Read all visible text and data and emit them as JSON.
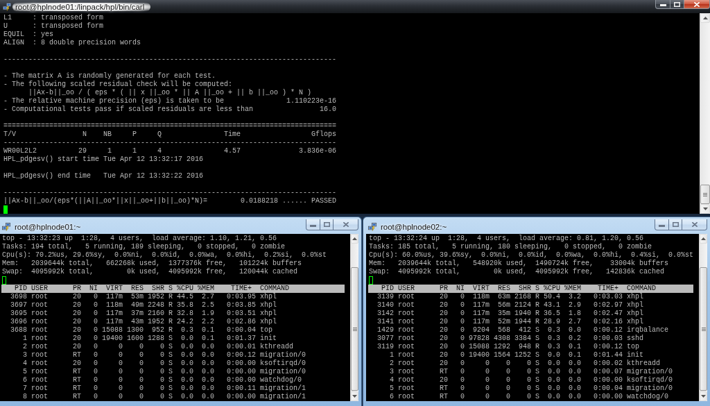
{
  "top_window": {
    "title": "root@hplnode01:/linpack/hpl/bin/carl",
    "active": true,
    "lines": [
      {
        "kind": "text",
        "text": "L1     : transposed form"
      },
      {
        "kind": "text",
        "text": "U      : transposed form"
      },
      {
        "kind": "text",
        "text": "EQUIL  : yes"
      },
      {
        "kind": "text",
        "text": "ALIGN  : 8 double precision words"
      },
      {
        "kind": "blank"
      },
      {
        "kind": "text",
        "text": "--------------------------------------------------------------------------------"
      },
      {
        "kind": "blank"
      },
      {
        "kind": "text",
        "text": "- The matrix A is randomly generated for each test."
      },
      {
        "kind": "text",
        "text": "- The following scaled residual check will be computed:"
      },
      {
        "kind": "text",
        "text": "      ||Ax-b||_oo / ( eps * ( || x ||_oo * || A ||_oo + || b ||_oo ) * N )"
      },
      {
        "kind": "text",
        "text": "- The relative machine precision (eps) is taken to be               1.110223e-16"
      },
      {
        "kind": "text",
        "text": "- Computational tests pass if scaled residuals are less than                16.0"
      },
      {
        "kind": "blank"
      },
      {
        "kind": "text",
        "text": "================================================================================"
      },
      {
        "kind": "text",
        "text": "T/V                N    NB     P     Q               Time                 Gflops"
      },
      {
        "kind": "text",
        "text": "--------------------------------------------------------------------------------"
      },
      {
        "kind": "text",
        "text": "WR00L2L2          29     1     1     4               4.57              3.836e-06"
      },
      {
        "kind": "text",
        "text": "HPL_pdgesv() start time Tue Apr 12 13:32:17 2016"
      },
      {
        "kind": "blank"
      },
      {
        "kind": "text",
        "text": "HPL_pdgesv() end time   Tue Apr 12 13:32:22 2016"
      },
      {
        "kind": "blank"
      },
      {
        "kind": "text",
        "text": "--------------------------------------------------------------------------------"
      },
      {
        "kind": "text",
        "text": "||Ax-b||_oo/(eps*(||A||_oo*||x||_oo+||b||_oo)*N)=        0.0188218 ...... PASSED"
      }
    ]
  },
  "bottom_windows": [
    {
      "title": "root@hplnode01:~",
      "active": false,
      "summary_lines": [
        "top - 13:32:23 up  1:28,  4 users,  load average: 1.10, 1.21, 0.56",
        "Tasks: 194 total,   5 running, 189 sleeping,   0 stopped,   0 zombie",
        "Cpu(s): 70.2%us, 29.6%sy,  0.0%ni,  0.0%id,  0.0%wa,  0.0%hi,  0.2%si,  0.0%st",
        "Mem:   2039644k total,   662268k used,  1377376k free,   101224k buffers",
        "Swap:  4095992k total,        0k used,  4095992k free,   120044k cached"
      ],
      "process_table": {
        "columns": [
          "PID",
          "USER",
          "PR",
          "NI",
          "VIRT",
          "RES",
          "SHR",
          "S",
          "%CPU",
          "%MEM",
          "TIME+",
          "COMMAND"
        ],
        "rows": [
          [
            "3698",
            "root",
            "20",
            "0",
            "117m",
            "53m",
            "1952",
            "R",
            "44.5",
            "2.7",
            "0:03.95",
            "xhpl"
          ],
          [
            "3697",
            "root",
            "20",
            "0",
            "118m",
            "49m",
            "2248",
            "R",
            "35.8",
            "2.5",
            "0:03.85",
            "xhpl"
          ],
          [
            "3695",
            "root",
            "20",
            "0",
            "117m",
            "37m",
            "2160",
            "R",
            "32.8",
            "1.9",
            "0:03.51",
            "xhpl"
          ],
          [
            "3696",
            "root",
            "20",
            "0",
            "117m",
            "43m",
            "1952",
            "R",
            "24.2",
            "2.2",
            "0:02.86",
            "xhpl"
          ],
          [
            "3688",
            "root",
            "20",
            "0",
            "15088",
            "1300",
            "952",
            "R",
            "0.3",
            "0.1",
            "0:00.04",
            "top"
          ],
          [
            "1",
            "root",
            "20",
            "0",
            "19400",
            "1600",
            "1288",
            "S",
            "0.0",
            "0.1",
            "0:01.37",
            "init"
          ],
          [
            "2",
            "root",
            "20",
            "0",
            "0",
            "0",
            "0",
            "S",
            "0.0",
            "0.0",
            "0:00.01",
            "kthreadd"
          ],
          [
            "3",
            "root",
            "RT",
            "0",
            "0",
            "0",
            "0",
            "S",
            "0.0",
            "0.0",
            "0:00.12",
            "migration/0"
          ],
          [
            "4",
            "root",
            "20",
            "0",
            "0",
            "0",
            "0",
            "S",
            "0.0",
            "0.0",
            "0:00.00",
            "ksoftirqd/0"
          ],
          [
            "5",
            "root",
            "RT",
            "0",
            "0",
            "0",
            "0",
            "S",
            "0.0",
            "0.0",
            "0:00.00",
            "migration/0"
          ],
          [
            "6",
            "root",
            "RT",
            "0",
            "0",
            "0",
            "0",
            "S",
            "0.0",
            "0.0",
            "0:00.00",
            "watchdog/0"
          ],
          [
            "7",
            "root",
            "RT",
            "0",
            "0",
            "0",
            "0",
            "S",
            "0.0",
            "0.0",
            "0:00.11",
            "migration/1"
          ],
          [
            "8",
            "root",
            "RT",
            "0",
            "0",
            "0",
            "0",
            "S",
            "0.0",
            "0.0",
            "0:00.00",
            "migration/1"
          ]
        ]
      }
    },
    {
      "title": "root@hplnode02:~",
      "active": false,
      "summary_lines": [
        "top - 13:32:24 up  1:28,  4 users,  load average: 0.81, 1.20, 0.56",
        "Tasks: 185 total,   5 running, 180 sleeping,   0 stopped,   0 zombie",
        "Cpu(s): 60.0%us, 39.6%sy,  0.0%ni,  0.0%id,  0.0%wa,  0.0%hi,  0.4%si,  0.0%st",
        "Mem:   2039644k total,   548920k used,  1490724k free,    33004k buffers",
        "Swap:  4095992k total,        0k used,  4095992k free,   142836k cached"
      ],
      "process_table": {
        "columns": [
          "PID",
          "USER",
          "PR",
          "NI",
          "VIRT",
          "RES",
          "SHR",
          "S",
          "%CPU",
          "%MEM",
          "TIME+",
          "COMMAND"
        ],
        "rows": [
          [
            "3139",
            "root",
            "20",
            "0",
            "118m",
            "63m",
            "2168",
            "R",
            "50.4",
            "3.2",
            "0:03.03",
            "xhpl"
          ],
          [
            "3140",
            "root",
            "20",
            "0",
            "117m",
            "56m",
            "2124",
            "R",
            "43.1",
            "2.9",
            "0:02.97",
            "xhpl"
          ],
          [
            "3142",
            "root",
            "20",
            "0",
            "117m",
            "35m",
            "1940",
            "R",
            "36.5",
            "1.8",
            "0:02.47",
            "xhpl"
          ],
          [
            "3141",
            "root",
            "20",
            "0",
            "117m",
            "52m",
            "1944",
            "R",
            "28.9",
            "2.7",
            "0:02.16",
            "xhpl"
          ],
          [
            "1429",
            "root",
            "20",
            "0",
            "9204",
            "568",
            "412",
            "S",
            "0.3",
            "0.0",
            "0:00.12",
            "irqbalance"
          ],
          [
            "3077",
            "root",
            "20",
            "0",
            "97828",
            "4308",
            "3384",
            "S",
            "0.3",
            "0.2",
            "0:00.03",
            "sshd"
          ],
          [
            "3119",
            "root",
            "20",
            "0",
            "15088",
            "1292",
            "948",
            "R",
            "0.3",
            "0.1",
            "0:00.12",
            "top"
          ],
          [
            "1",
            "root",
            "20",
            "0",
            "19400",
            "1564",
            "1252",
            "S",
            "0.0",
            "0.1",
            "0:01.44",
            "init"
          ],
          [
            "2",
            "root",
            "20",
            "0",
            "0",
            "0",
            "0",
            "S",
            "0.0",
            "0.0",
            "0:00.02",
            "kthreadd"
          ],
          [
            "3",
            "root",
            "RT",
            "0",
            "0",
            "0",
            "0",
            "S",
            "0.0",
            "0.0",
            "0:00.07",
            "migration/0"
          ],
          [
            "4",
            "root",
            "20",
            "0",
            "0",
            "0",
            "0",
            "S",
            "0.0",
            "0.0",
            "0:00.00",
            "ksoftirqd/0"
          ],
          [
            "5",
            "root",
            "RT",
            "0",
            "0",
            "0",
            "0",
            "S",
            "0.0",
            "0.0",
            "0:00.04",
            "migration/0"
          ],
          [
            "6",
            "root",
            "RT",
            "0",
            "0",
            "0",
            "0",
            "S",
            "0.0",
            "0.0",
            "0:00.00",
            "watchdog/0"
          ]
        ]
      }
    }
  ]
}
